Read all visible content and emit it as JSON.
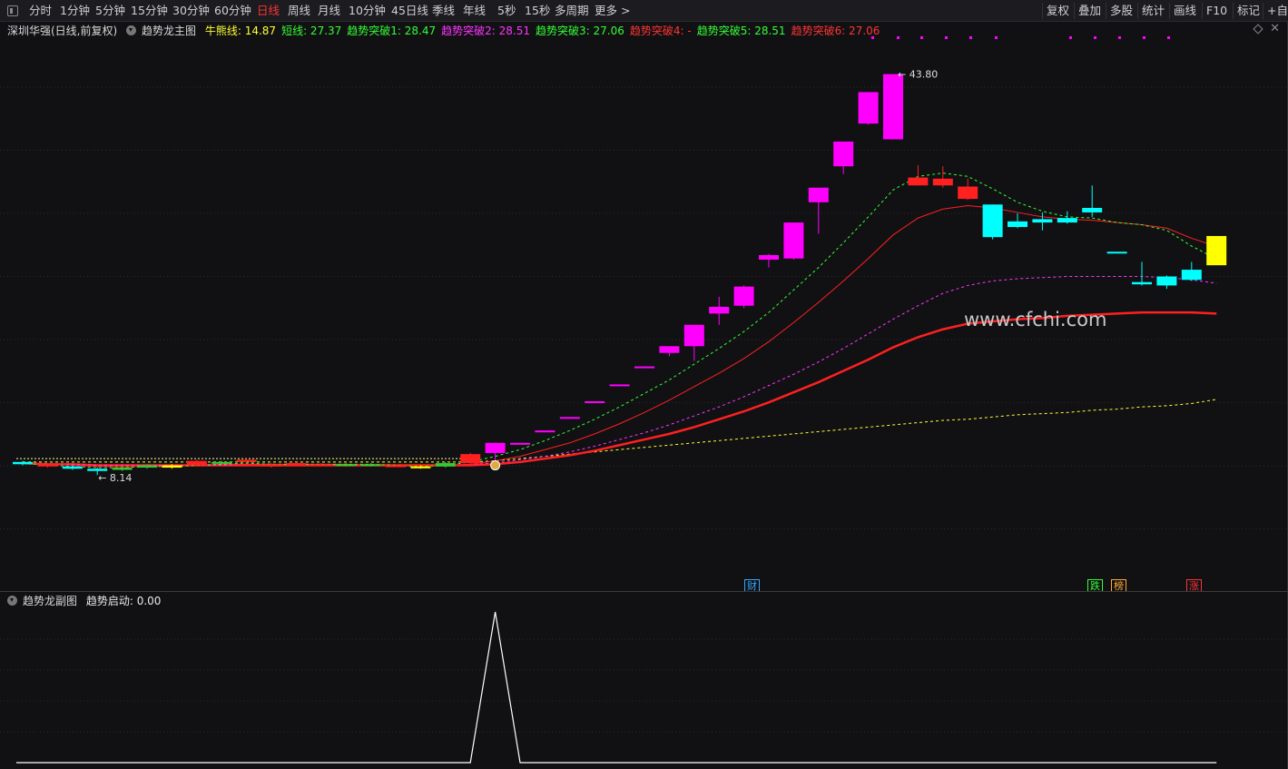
{
  "toolbar": {
    "periods": [
      {
        "label": "分时",
        "active": false
      },
      {
        "label": "1分钟",
        "active": false
      },
      {
        "label": "5分钟",
        "active": false
      },
      {
        "label": "15分钟",
        "active": false
      },
      {
        "label": "30分钟",
        "active": false
      },
      {
        "label": "60分钟",
        "active": false
      },
      {
        "label": "日线",
        "active": true
      },
      {
        "label": "周线",
        "active": false
      },
      {
        "label": "月线",
        "active": false
      },
      {
        "label": "10分钟",
        "active": false
      },
      {
        "label": "45日线",
        "active": false
      },
      {
        "label": "季线",
        "active": false
      },
      {
        "label": "年线",
        "active": false
      },
      {
        "label": "5秒",
        "active": false
      },
      {
        "label": "15秒",
        "active": false
      },
      {
        "label": "多周期",
        "active": false
      },
      {
        "label": "更多 >",
        "active": false
      }
    ],
    "right_buttons": [
      "复权",
      "叠加",
      "多股",
      "统计",
      "画线",
      "F10",
      "标记",
      "+自选"
    ]
  },
  "main": {
    "stock": "深圳华强(日线,前复权)",
    "indicator": "趋势龙主图",
    "legend": [
      {
        "label": "牛熊线: 14.87",
        "color": "#ffff33"
      },
      {
        "label": "短线: 27.37",
        "color": "#33ff33"
      },
      {
        "label": "趋势突破1: 28.47",
        "color": "#33ff33"
      },
      {
        "label": "趋势突破2: 28.51",
        "color": "#ff33ff"
      },
      {
        "label": "趋势突破3: 27.06",
        "color": "#33ff33"
      },
      {
        "label": "趋势突破4: -",
        "color": "#ff3333"
      },
      {
        "label": "趋势突破5: 28.51",
        "color": "#33ff33"
      },
      {
        "label": "趋势突破6: 27.06",
        "color": "#ff3333"
      }
    ],
    "high_label": "43.80",
    "low_label": "8.14",
    "watermark": "www.cfchi.com",
    "event_tags": [
      {
        "text": "财",
        "color": "#33aaff"
      },
      {
        "text": "跌",
        "color": "#33ff33"
      },
      {
        "text": "榜",
        "color": "#ffaa33"
      },
      {
        "text": "涨",
        "color": "#ff3333"
      }
    ]
  },
  "sub": {
    "indicator": "趋势龙副图",
    "legend": "趋势启动: 0.00"
  },
  "colors": {
    "up": "#ff2020",
    "down": "#00ffff",
    "hot": "#ff00ff",
    "yellow": "#ffff00",
    "bull_bear": "#ffff33"
  },
  "chart_data": {
    "type": "candlestick",
    "ylim": [
      0,
      47
    ],
    "high": 43.8,
    "low": 8.14,
    "candles": [
      {
        "o": 9.3,
        "c": 9.1,
        "h": 9.4,
        "l": 9.0,
        "k": "down"
      },
      {
        "o": 9.1,
        "c": 8.9,
        "h": 9.2,
        "l": 8.8,
        "k": "up"
      },
      {
        "o": 8.9,
        "c": 8.7,
        "h": 9.0,
        "l": 8.6,
        "k": "down"
      },
      {
        "o": 8.7,
        "c": 8.5,
        "h": 8.8,
        "l": 8.14,
        "k": "down"
      },
      {
        "o": 8.6,
        "c": 8.8,
        "h": 8.9,
        "l": 8.5,
        "k": "green"
      },
      {
        "o": 8.8,
        "c": 9.0,
        "h": 9.1,
        "l": 8.7,
        "k": "green"
      },
      {
        "o": 9.0,
        "c": 8.8,
        "h": 9.1,
        "l": 8.7,
        "k": "yellow"
      },
      {
        "o": 9.0,
        "c": 9.4,
        "h": 9.5,
        "l": 8.9,
        "k": "up"
      },
      {
        "o": 9.3,
        "c": 9.2,
        "h": 9.4,
        "l": 9.1,
        "k": "green"
      },
      {
        "o": 9.3,
        "c": 9.5,
        "h": 9.6,
        "l": 9.2,
        "k": "up"
      },
      {
        "o": 9.1,
        "c": 8.9,
        "h": 9.2,
        "l": 8.8,
        "k": "up"
      },
      {
        "o": 9.0,
        "c": 9.2,
        "h": 9.3,
        "l": 8.9,
        "k": "up"
      },
      {
        "o": 9.1,
        "c": 9.0,
        "h": 9.2,
        "l": 8.9,
        "k": "up"
      },
      {
        "o": 9.0,
        "c": 9.1,
        "h": 9.2,
        "l": 8.9,
        "k": "green"
      },
      {
        "o": 9.1,
        "c": 9.0,
        "h": 9.2,
        "l": 8.9,
        "k": "green"
      },
      {
        "o": 9.0,
        "c": 9.0,
        "h": 9.1,
        "l": 8.9,
        "k": "up"
      },
      {
        "o": 8.9,
        "c": 8.8,
        "h": 9.0,
        "l": 8.7,
        "k": "yellow"
      },
      {
        "o": 8.9,
        "c": 9.2,
        "h": 9.3,
        "l": 8.8,
        "k": "green"
      },
      {
        "o": 9.2,
        "c": 10.0,
        "h": 10.1,
        "l": 9.1,
        "k": "up"
      },
      {
        "o": 10.1,
        "c": 11.0,
        "h": 11.0,
        "l": 9.1,
        "k": "hot"
      },
      {
        "o": 11.0,
        "c": 11.0,
        "h": 11.0,
        "l": 11.0,
        "k": "hot"
      },
      {
        "o": 12.1,
        "c": 12.1,
        "h": 12.1,
        "l": 12.1,
        "k": "hot"
      },
      {
        "o": 13.3,
        "c": 13.3,
        "h": 13.3,
        "l": 13.3,
        "k": "hot"
      },
      {
        "o": 14.7,
        "c": 14.7,
        "h": 14.7,
        "l": 14.7,
        "k": "hot"
      },
      {
        "o": 16.2,
        "c": 16.2,
        "h": 16.2,
        "l": 16.2,
        "k": "hot"
      },
      {
        "o": 17.8,
        "c": 17.8,
        "h": 17.8,
        "l": 17.8,
        "k": "hot"
      },
      {
        "o": 19.0,
        "c": 19.6,
        "h": 19.6,
        "l": 18.7,
        "k": "hot"
      },
      {
        "o": 19.6,
        "c": 21.5,
        "h": 21.5,
        "l": 18.3,
        "k": "hot"
      },
      {
        "o": 22.5,
        "c": 23.1,
        "h": 24.0,
        "l": 21.5,
        "k": "hot"
      },
      {
        "o": 23.2,
        "c": 24.9,
        "h": 25.0,
        "l": 23.0,
        "k": "hot"
      },
      {
        "o": 27.3,
        "c": 27.7,
        "h": 27.8,
        "l": 26.6,
        "k": "hot"
      },
      {
        "o": 27.4,
        "c": 30.6,
        "h": 30.6,
        "l": 27.3,
        "k": "hot"
      },
      {
        "o": 32.4,
        "c": 33.7,
        "h": 33.7,
        "l": 29.6,
        "k": "hot"
      },
      {
        "o": 35.6,
        "c": 37.8,
        "h": 37.8,
        "l": 34.9,
        "k": "hot"
      },
      {
        "o": 39.4,
        "c": 42.2,
        "h": 42.2,
        "l": 39.3,
        "k": "hot"
      },
      {
        "o": 38.0,
        "c": 43.8,
        "h": 43.8,
        "l": 38.0,
        "k": "hot"
      },
      {
        "o": 34.6,
        "c": 33.9,
        "h": 35.7,
        "l": 33.9,
        "k": "up"
      },
      {
        "o": 34.5,
        "c": 33.9,
        "h": 35.6,
        "l": 33.7,
        "k": "up"
      },
      {
        "o": 33.8,
        "c": 32.7,
        "h": 34.5,
        "l": 32.6,
        "k": "up"
      },
      {
        "o": 32.2,
        "c": 29.3,
        "h": 32.2,
        "l": 29.1,
        "k": "down"
      },
      {
        "o": 30.7,
        "c": 30.2,
        "h": 31.4,
        "l": 30.1,
        "k": "down"
      },
      {
        "o": 30.6,
        "c": 30.9,
        "h": 31.5,
        "l": 29.9,
        "k": "down"
      },
      {
        "o": 30.6,
        "c": 31.0,
        "h": 31.6,
        "l": 30.5,
        "k": "down"
      },
      {
        "o": 31.5,
        "c": 31.9,
        "h": 33.9,
        "l": 31.1,
        "k": "down"
      },
      {
        "o": 28.0,
        "c": 28.0,
        "h": 28.0,
        "l": 28.0,
        "k": "down"
      },
      {
        "o": 25.1,
        "c": 25.3,
        "h": 27.1,
        "l": 25.0,
        "k": "down"
      },
      {
        "o": 25.0,
        "c": 25.8,
        "h": 25.9,
        "l": 24.7,
        "k": "down"
      },
      {
        "o": 25.5,
        "c": 26.4,
        "h": 27.1,
        "l": 25.4,
        "k": "down"
      },
      {
        "o": 26.8,
        "c": 29.4,
        "h": 29.4,
        "l": 26.8,
        "k": "yellow"
      }
    ],
    "bull_bear_line": [
      9.3,
      9.3,
      9.3,
      9.3,
      9.3,
      9.3,
      9.3,
      9.3,
      9.3,
      9.3,
      9.3,
      9.3,
      9.3,
      9.3,
      9.3,
      9.3,
      9.3,
      9.3,
      9.3,
      9.4,
      9.6,
      9.8,
      10.0,
      10.2,
      10.4,
      10.6,
      10.8,
      11.0,
      11.2,
      11.4,
      11.6,
      11.8,
      12.0,
      12.2,
      12.4,
      12.6,
      12.8,
      13.0,
      13.1,
      13.3,
      13.5,
      13.6,
      13.7,
      13.9,
      14.0,
      14.2,
      14.3,
      14.5,
      14.87
    ],
    "short_line": [
      9.2,
      9.0,
      8.9,
      8.8,
      8.8,
      8.9,
      8.9,
      9.0,
      9.1,
      9.2,
      9.1,
      9.1,
      9.1,
      9.1,
      9.1,
      9.0,
      8.9,
      9.0,
      9.3,
      9.8,
      10.4,
      11.2,
      12.1,
      13.1,
      14.2,
      15.4,
      16.6,
      18.0,
      19.4,
      20.9,
      22.6,
      24.6,
      26.6,
      28.8,
      31.1,
      33.5,
      34.7,
      35.0,
      34.7,
      33.6,
      32.4,
      31.6,
      31.1,
      31.0,
      30.6,
      30.4,
      29.9,
      28.5,
      27.37
    ],
    "break_line_1": [
      9.2,
      9.1,
      9.0,
      8.9,
      8.9,
      8.9,
      8.9,
      9.0,
      9.1,
      9.1,
      9.1,
      9.1,
      9.1,
      9.1,
      9.0,
      9.0,
      9.0,
      9.0,
      9.1,
      9.4,
      9.8,
      10.4,
      11.0,
      11.8,
      12.7,
      13.7,
      14.8,
      16.0,
      17.2,
      18.5,
      20.0,
      21.7,
      23.5,
      25.4,
      27.4,
      29.5,
      31.0,
      31.8,
      32.1,
      31.9,
      31.5,
      31.1,
      30.9,
      30.8,
      30.6,
      30.4,
      30.1,
      29.2,
      28.47
    ],
    "break_line_2": [
      9.2,
      9.1,
      9.1,
      9.0,
      9.0,
      9.0,
      9.0,
      9.0,
      9.0,
      9.1,
      9.1,
      9.1,
      9.1,
      9.0,
      9.0,
      9.0,
      9.0,
      9.0,
      9.1,
      9.2,
      9.5,
      9.8,
      10.2,
      10.7,
      11.3,
      11.9,
      12.6,
      13.4,
      14.2,
      15.1,
      16.1,
      17.1,
      18.2,
      19.4,
      20.7,
      22.0,
      23.2,
      24.3,
      25.0,
      25.4,
      25.6,
      25.7,
      25.8,
      25.8,
      25.8,
      25.8,
      25.7,
      25.5,
      25.2
    ],
    "break_line_3": [
      9.2,
      9.1,
      9.1,
      9.0,
      9.0,
      9.0,
      9.0,
      9.0,
      9.0,
      9.0,
      9.0,
      9.0,
      9.0,
      9.0,
      9.0,
      9.0,
      9.0,
      9.0,
      9.0,
      9.1,
      9.3,
      9.6,
      9.9,
      10.3,
      10.8,
      11.3,
      11.8,
      12.4,
      13.1,
      13.8,
      14.6,
      15.5,
      16.4,
      17.4,
      18.4,
      19.5,
      20.4,
      21.1,
      21.6,
      21.8,
      22.0,
      22.1,
      22.3,
      22.4,
      22.5,
      22.6,
      22.6,
      22.6,
      22.5
    ]
  },
  "sub_chart_data": {
    "type": "line",
    "values": [
      0,
      0,
      0,
      0,
      0,
      0,
      0,
      0,
      0,
      0,
      0,
      0,
      0,
      0,
      0,
      0,
      0,
      0,
      0,
      1,
      0,
      0,
      0,
      0,
      0,
      0,
      0,
      0,
      0,
      0,
      0,
      0,
      0,
      0,
      0,
      0,
      0,
      0,
      0,
      0,
      0,
      0,
      0,
      0,
      0,
      0,
      0,
      0,
      0
    ]
  }
}
